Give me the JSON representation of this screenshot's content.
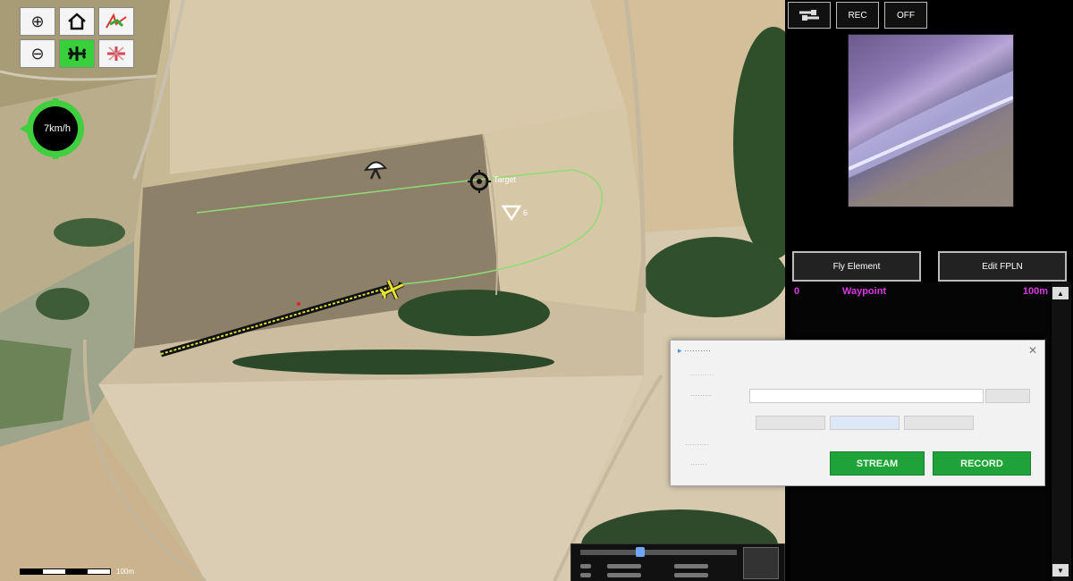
{
  "map": {
    "speed": "7km/h",
    "target_label": "Target",
    "waypoint_label": "6",
    "scale_label": "100m",
    "tools": [
      {
        "name": "zoom-in-icon",
        "glyph": "⊕"
      },
      {
        "name": "home-icon",
        "glyph": "⌂"
      },
      {
        "name": "waypoints-icon",
        "glyph": "✈"
      },
      {
        "name": "zoom-out-icon",
        "glyph": "⊖"
      },
      {
        "name": "plane-icon",
        "glyph": "✈"
      },
      {
        "name": "disabled-plane-icon",
        "glyph": "✈"
      }
    ]
  },
  "panel": {
    "top_buttons": [
      "REC",
      "OFF"
    ],
    "fly_element": "Fly Element",
    "edit_fpln": "Edit FPLN",
    "list_row": {
      "index": "0",
      "type": "Waypoint",
      "distance": "100m"
    }
  },
  "dialog": {
    "stream": "STREAM",
    "record": "RECORD"
  },
  "colors": {
    "accent": "#39d13b",
    "waypoint_text": "#d93be0",
    "path": "#8fdc74"
  }
}
